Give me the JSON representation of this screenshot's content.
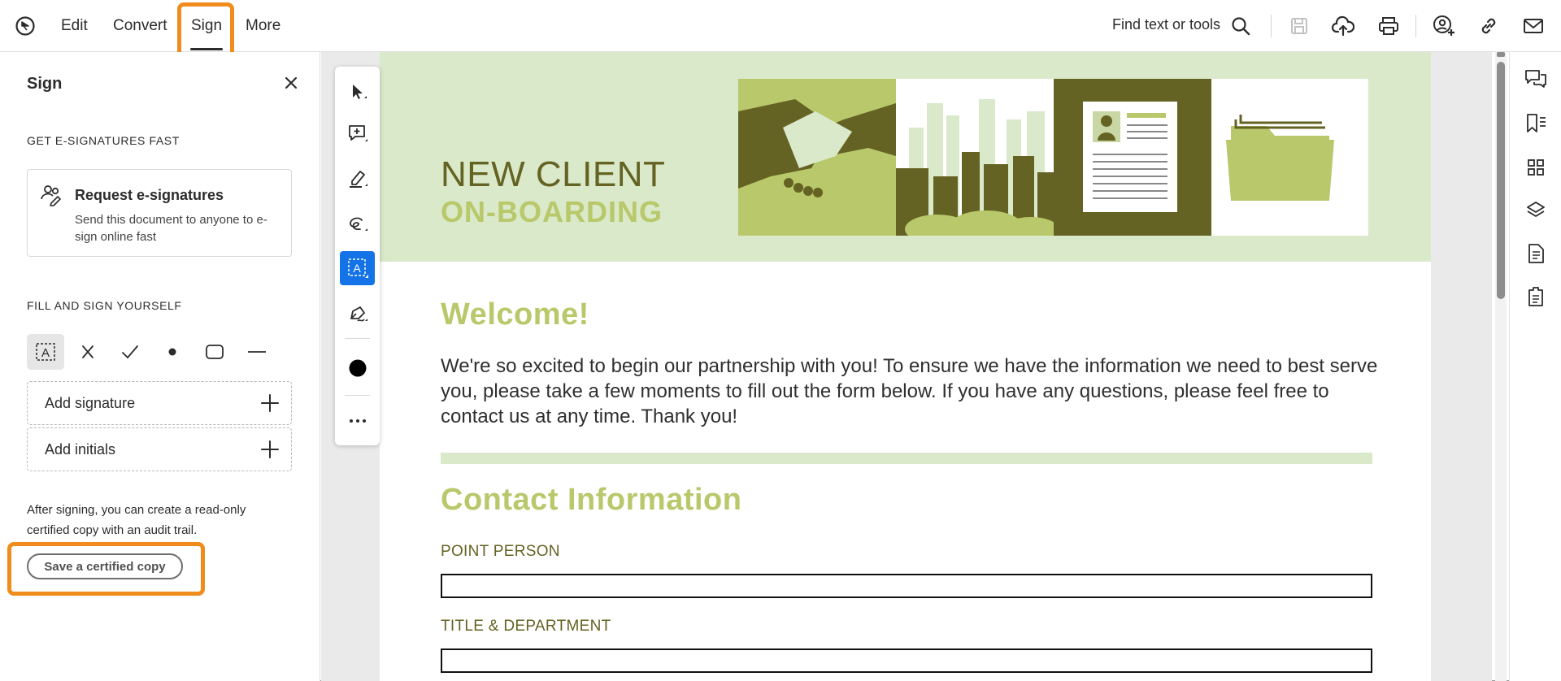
{
  "topbar": {
    "menu": [
      "Edit",
      "Convert",
      "Sign",
      "More"
    ],
    "active_menu": "Sign",
    "find_placeholder": "Find text or tools",
    "icons": [
      "acrobat-home-icon",
      "search-icon",
      "save-icon",
      "upload-cloud-icon",
      "print-icon",
      "share-user-icon",
      "link-icon",
      "mail-icon"
    ]
  },
  "sign_panel": {
    "title": "Sign",
    "section_fast": "GET E-SIGNATURES FAST",
    "request_title": "Request e-signatures",
    "request_desc": "Send this document to anyone to e-sign online fast",
    "section_fill": "FILL AND SIGN YOURSELF",
    "tools": [
      "text-field-icon",
      "cross-mark-icon",
      "check-mark-icon",
      "dot-icon",
      "rectangle-icon",
      "line-icon"
    ],
    "add_signature": "Add signature",
    "add_initials": "Add initials",
    "after_text": "After signing, you can create a read-only certified copy with an audit trail.",
    "certified_button": "Save a certified copy"
  },
  "floating_toolbar": {
    "tools": [
      "select-cursor-icon",
      "add-comment-icon",
      "highlight-pen-icon",
      "freehand-draw-icon",
      "add-text-icon",
      "sign-pen-icon",
      "color-dot-icon",
      "more-options-icon"
    ],
    "active": "add-text-icon"
  },
  "document": {
    "banner_title": "NEW CLIENT",
    "banner_subtitle": "ON-BOARDING",
    "welcome": "Welcome!",
    "intro": "We're so excited to begin our partnership with you! To ensure we have the information we need to best serve you, please take a few moments to fill out the form below. If you have any questions, please feel free to contact us at any time. Thank you!",
    "contact_heading": "Contact Information",
    "fields": [
      "POINT PERSON",
      "TITLE & DEPARTMENT"
    ]
  },
  "right_rail": {
    "icons": [
      "comments-icon",
      "bookmarks-icon",
      "thumbnails-icon",
      "layers-icon",
      "document-properties-icon",
      "tags-icon"
    ]
  },
  "colors": {
    "highlight": "#f08c1c",
    "accent_blue": "#1473e6",
    "banner_bg": "#d9e9c9",
    "olive_dark": "#656323",
    "olive_light": "#b8c86a"
  }
}
